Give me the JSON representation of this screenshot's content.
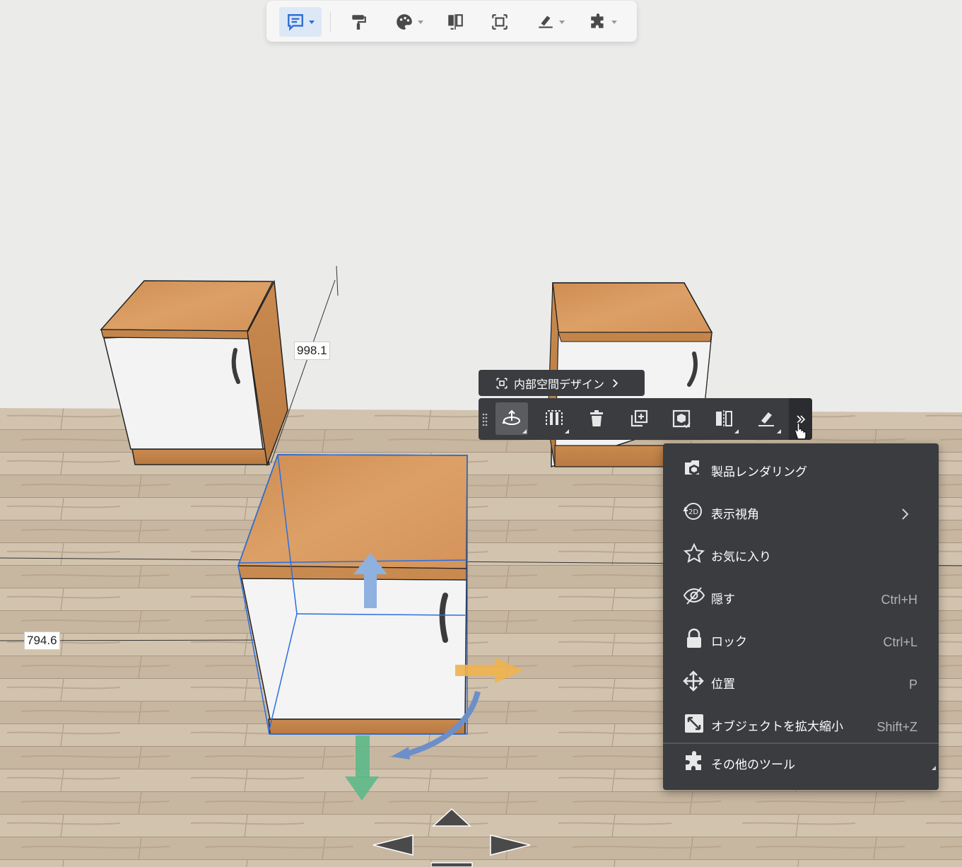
{
  "top_toolbar": {
    "items": [
      {
        "icon": "floorplan-list-icon",
        "active": true,
        "has_dropdown": true
      },
      {
        "icon": "paint-roller-icon",
        "active": false,
        "has_dropdown": false
      },
      {
        "icon": "material-palette-icon",
        "active": false,
        "has_dropdown": true
      },
      {
        "icon": "mirror-flip-icon",
        "active": false,
        "has_dropdown": false
      },
      {
        "icon": "select-frame-icon",
        "active": false,
        "has_dropdown": false
      },
      {
        "icon": "measure-tool-icon",
        "active": false,
        "has_dropdown": true
      },
      {
        "icon": "plugin-puzzle-icon",
        "active": false,
        "has_dropdown": true
      }
    ]
  },
  "dimensions": {
    "height_label": "998.1",
    "width_label": "794.6"
  },
  "interior_design_button": {
    "label": "内部空間デザイン"
  },
  "object_toolbar": {
    "items": [
      {
        "icon": "transform-move-icon",
        "active": true
      },
      {
        "icon": "align-columns-icon",
        "active": false
      },
      {
        "icon": "trash-icon",
        "active": false
      },
      {
        "icon": "duplicate-add-icon",
        "active": false
      },
      {
        "icon": "replace-model-icon",
        "active": false
      },
      {
        "icon": "mirror-panels-icon",
        "active": false
      },
      {
        "icon": "measure-ruler-icon",
        "active": false
      }
    ],
    "more_icon": "double-chevron-right-icon"
  },
  "context_menu": {
    "items": [
      {
        "label": "製品レンダリング",
        "icon": "render-camera-icon",
        "shortcut": "",
        "submenu": false
      },
      {
        "label": "表示視角",
        "icon": "view-angle-2d-icon",
        "shortcut": "",
        "submenu": true
      },
      {
        "label": "お気に入り",
        "icon": "star-icon",
        "shortcut": "",
        "submenu": false
      },
      {
        "label": "隠す",
        "icon": "eye-hidden-icon",
        "shortcut": "Ctrl+H",
        "submenu": false
      },
      {
        "label": "ロック",
        "icon": "lock-icon",
        "shortcut": "Ctrl+L",
        "submenu": false
      },
      {
        "label": "位置",
        "icon": "move-arrows-icon",
        "shortcut": "P",
        "submenu": false
      },
      {
        "label": "オブジェクトを拡大縮小",
        "icon": "scale-resize-icon",
        "shortcut": "Shift+Z",
        "submenu": false
      }
    ],
    "footer_item": {
      "label": "その他のツール",
      "icon": "plugin-puzzle-icon"
    }
  },
  "colors": {
    "accent": "#2f6ed6",
    "panel_dark": "#3a3c40",
    "wood_top": "#d99a5e",
    "floor": "#c9b8a3",
    "wall": "#ebebea"
  }
}
